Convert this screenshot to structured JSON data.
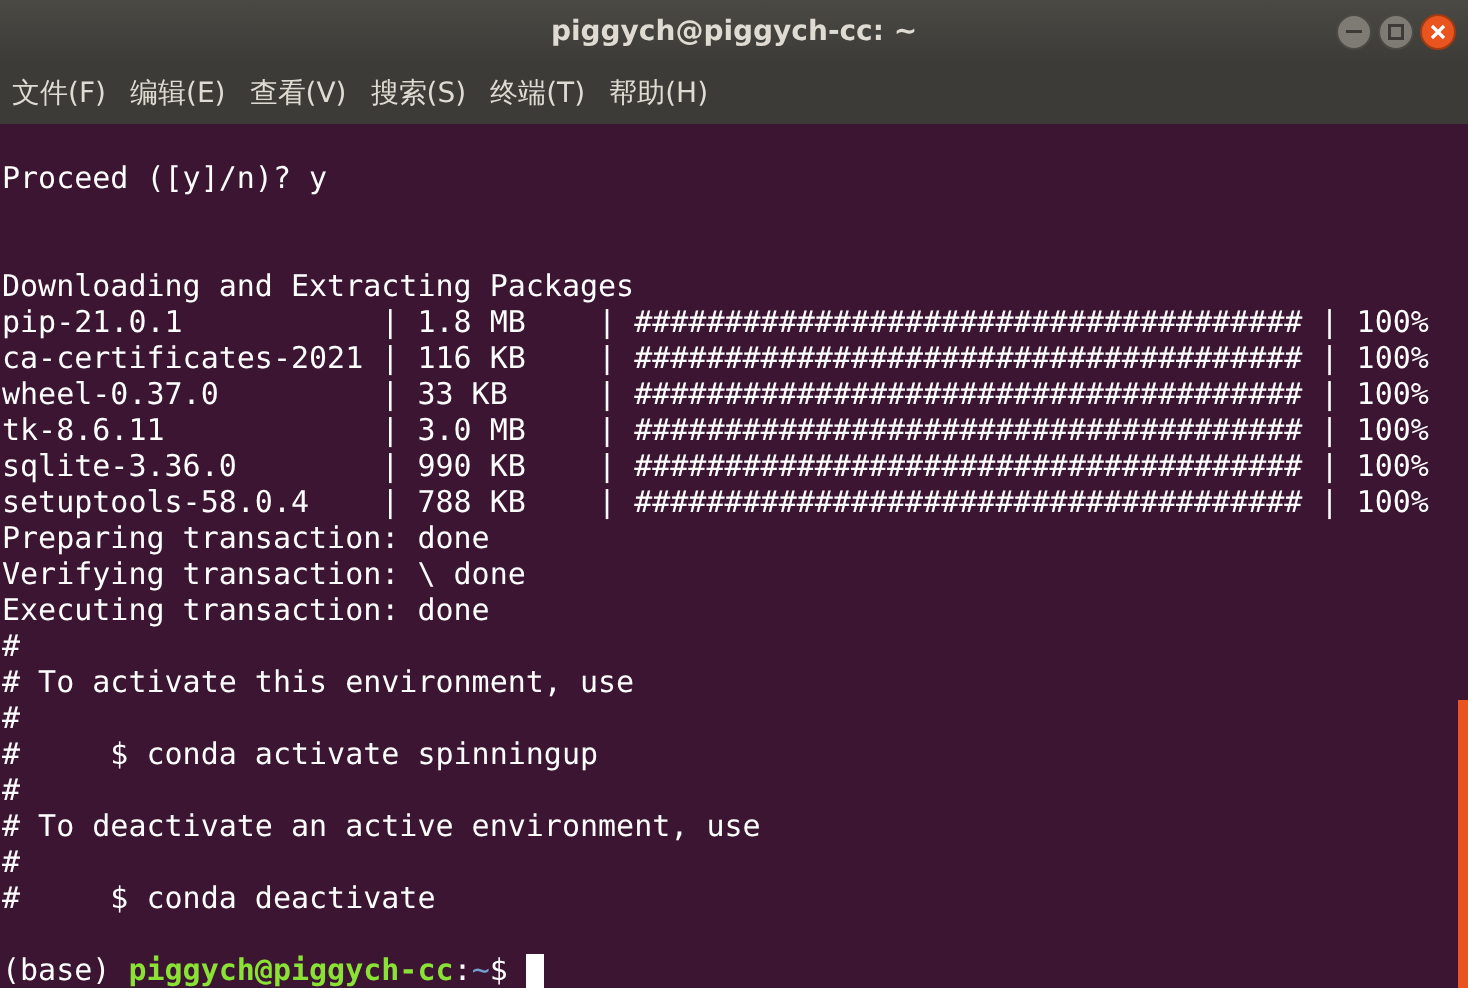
{
  "window": {
    "title": "piggych@piggych-cc: ~"
  },
  "menu": [
    "文件(F)",
    "编辑(E)",
    "查看(V)",
    "搜索(S)",
    "终端(T)",
    "帮助(H)"
  ],
  "terminal": {
    "lines": [
      {
        "kind": "blank"
      },
      {
        "kind": "text",
        "text": "Proceed ([y]/n)? y"
      },
      {
        "kind": "blank"
      },
      {
        "kind": "blank"
      },
      {
        "kind": "text",
        "text": "Downloading and Extracting Packages"
      },
      {
        "kind": "text",
        "text": "pip-21.0.1           | 1.8 MB    | ##################################### | 100%"
      },
      {
        "kind": "text",
        "text": "ca-certificates-2021 | 116 KB    | ##################################### | 100%"
      },
      {
        "kind": "text",
        "text": "wheel-0.37.0         | 33 KB     | ##################################### | 100%"
      },
      {
        "kind": "text",
        "text": "tk-8.6.11            | 3.0 MB    | ##################################### | 100%"
      },
      {
        "kind": "text",
        "text": "sqlite-3.36.0        | 990 KB    | ##################################### | 100%"
      },
      {
        "kind": "text",
        "text": "setuptools-58.0.4    | 788 KB    | ##################################### | 100%"
      },
      {
        "kind": "text",
        "text": "Preparing transaction: done"
      },
      {
        "kind": "text",
        "text": "Verifying transaction: \\ done"
      },
      {
        "kind": "text",
        "text": "Executing transaction: done"
      },
      {
        "kind": "text",
        "text": "#"
      },
      {
        "kind": "text",
        "text": "# To activate this environment, use"
      },
      {
        "kind": "text",
        "text": "#"
      },
      {
        "kind": "text",
        "text": "#     $ conda activate spinningup"
      },
      {
        "kind": "text",
        "text": "#"
      },
      {
        "kind": "text",
        "text": "# To deactivate an active environment, use"
      },
      {
        "kind": "text",
        "text": "#"
      },
      {
        "kind": "text",
        "text": "#     $ conda deactivate"
      },
      {
        "kind": "blank"
      },
      {
        "kind": "prompt",
        "env": "(base) ",
        "user_host": "piggych@piggych-cc",
        "separator": ":",
        "path": "~",
        "symbol": "$ "
      }
    ]
  }
}
